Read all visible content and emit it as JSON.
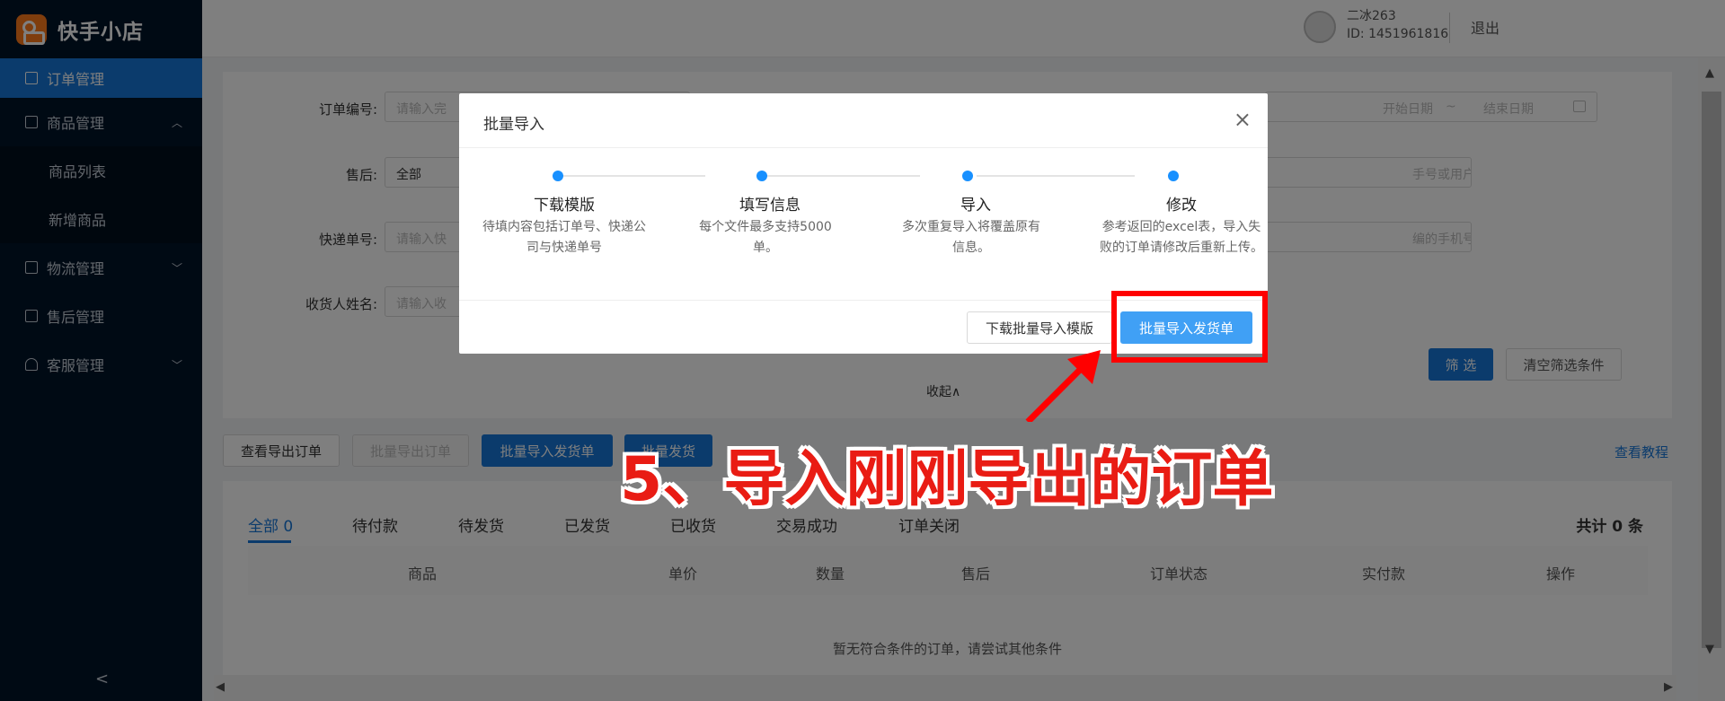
{
  "app": {
    "logo_text": "快手小店"
  },
  "sidebar": {
    "items": [
      {
        "label": "订单管理"
      },
      {
        "label": "商品管理"
      },
      {
        "label": "商品列表"
      },
      {
        "label": "新增商品"
      },
      {
        "label": "物流管理"
      },
      {
        "label": "售后管理"
      },
      {
        "label": "客服管理"
      }
    ]
  },
  "header": {
    "user_name": "二冰263",
    "user_id": "ID: 1451961816",
    "logout": "退出"
  },
  "filters": {
    "order_no_label": "订单编号:",
    "order_no_placeholder": "请输入完",
    "after_sale_label": "售后:",
    "after_sale_value": "全部",
    "tracking_label": "快递单号:",
    "tracking_placeholder": "请输入快",
    "receiver_label": "收货人姓名:",
    "receiver_placeholder": "请输入收",
    "start_date": "开始日期",
    "date_sep": "~",
    "end_date": "结束日期",
    "phone_or_user_placeholder": "手号或用户ID",
    "phone_placeholder": "编的手机号",
    "filter_button": "筛 选",
    "clear_button": "清空筛选条件",
    "collapse": "收起"
  },
  "toolbar": {
    "view_export": "查看导出订单",
    "batch_export": "批量导出订单",
    "batch_import": "批量导入发货单",
    "batch_ship": "批量发货",
    "tutorial": "查看教程"
  },
  "tabs": [
    {
      "label": "全部 0"
    },
    {
      "label": "待付款"
    },
    {
      "label": "待发货"
    },
    {
      "label": "已发货"
    },
    {
      "label": "已收货"
    },
    {
      "label": "交易成功"
    },
    {
      "label": "订单关闭"
    }
  ],
  "total": "共计 0 条",
  "table": {
    "columns": [
      "商品",
      "单价",
      "数量",
      "售后",
      "订单状态",
      "实付款",
      "操作"
    ],
    "empty": "暂无符合条件的订单，请尝试其他条件"
  },
  "modal": {
    "title": "批量导入",
    "steps": [
      {
        "title": "下载模版",
        "desc": "待填内容包括订单号、快递公司与快递单号"
      },
      {
        "title": "填写信息",
        "desc": "每个文件最多支持5000单。"
      },
      {
        "title": "导入",
        "desc": "多次重复导入将覆盖原有信息。"
      },
      {
        "title": "修改",
        "desc": "参考返回的excel表，导入失败的订单请修改后重新上传。"
      }
    ],
    "download_button": "下载批量导入模版",
    "import_button": "批量导入发货单"
  },
  "annotation": {
    "text": "5、导入刚刚导出的订单",
    "color": "#e91c14"
  },
  "colors": {
    "primary": "#1677d8",
    "sidebar": "#001529",
    "highlight": "#ff0000"
  }
}
